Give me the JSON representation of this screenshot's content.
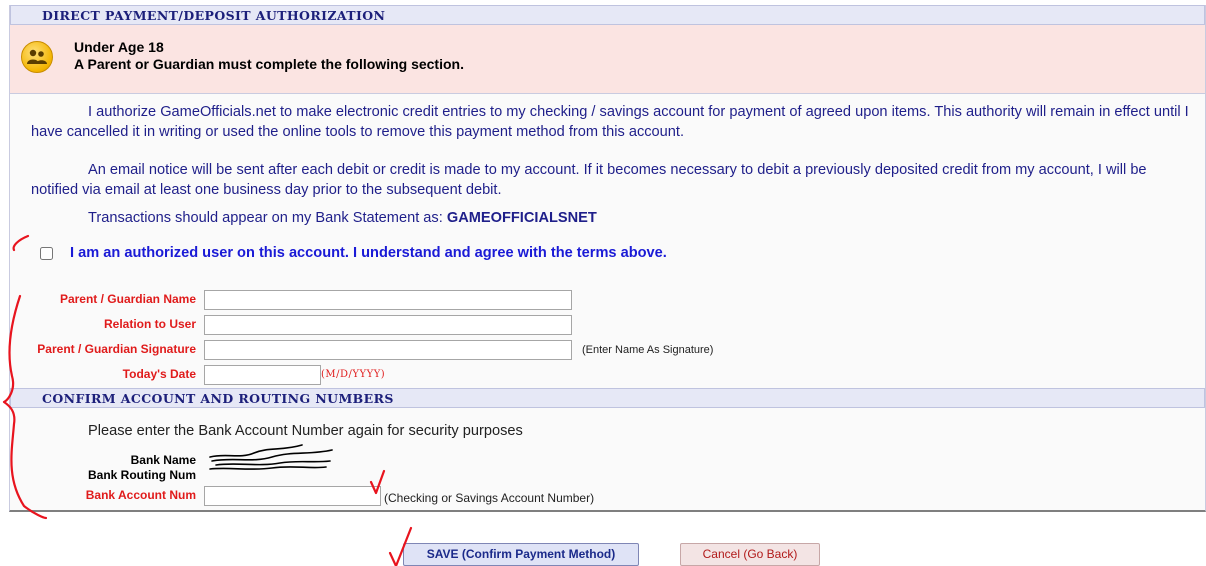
{
  "sections": {
    "authorization_title": "DIRECT PAYMENT/DEPOSIT AUTHORIZATION",
    "confirm_title": "CONFIRM ACCOUNT AND ROUTING NUMBERS"
  },
  "alert": {
    "icon": "users-icon",
    "title": "Under Age 18",
    "subtitle": "A Parent or Guardian must complete the following section."
  },
  "terms": {
    "paragraph1": "I authorize GameOfficials.net to make electronic credit entries to my checking / savings account for payment of agreed upon items. This authority will remain in effect until I have cancelled it in writing or used the online tools to remove this payment method from this account.",
    "paragraph2": "An email notice will be sent after each debit or credit is made to my account. If it becomes necessary to debit a previously deposited credit from my account, I will be notified via email at least one business day prior to the subsequent debit.",
    "statement_prefix": "Transactions should appear on my Bank Statement as:",
    "statement_name": "GAMEOFFICIALSNET",
    "agree_label": "I am an authorized user on this account. I understand and agree with the terms above.",
    "agree_checked": false
  },
  "form": {
    "guardian_name_label": "Parent / Guardian Name",
    "guardian_name_value": "",
    "relation_label": "Relation to User",
    "relation_value": "",
    "signature_label": "Parent / Guardian Signature",
    "signature_value": "",
    "signature_hint": "(Enter Name As Signature)",
    "date_label": "Today's Date",
    "date_value": "",
    "date_hint": "(M/D/YYYY)"
  },
  "confirm": {
    "instruction": "Please enter the Bank Account Number again for security purposes",
    "bank_name_label": "Bank Name",
    "routing_label": "Bank Routing Num",
    "account_label": "Bank Account Num",
    "account_value": "",
    "account_hint": "(Checking or Savings Account Number)"
  },
  "buttons": {
    "save": "SAVE (Confirm Payment Method)",
    "cancel": "Cancel (Go Back)"
  },
  "colors": {
    "header_bg": "#e6e8f6",
    "header_text": "#1c1f7a",
    "alert_bg": "#fbe4e2",
    "body_text": "#1f1f8a",
    "label_red": "#e01b1b",
    "agree_blue": "#1a1ad6",
    "annotation_red": "#e8141e"
  }
}
